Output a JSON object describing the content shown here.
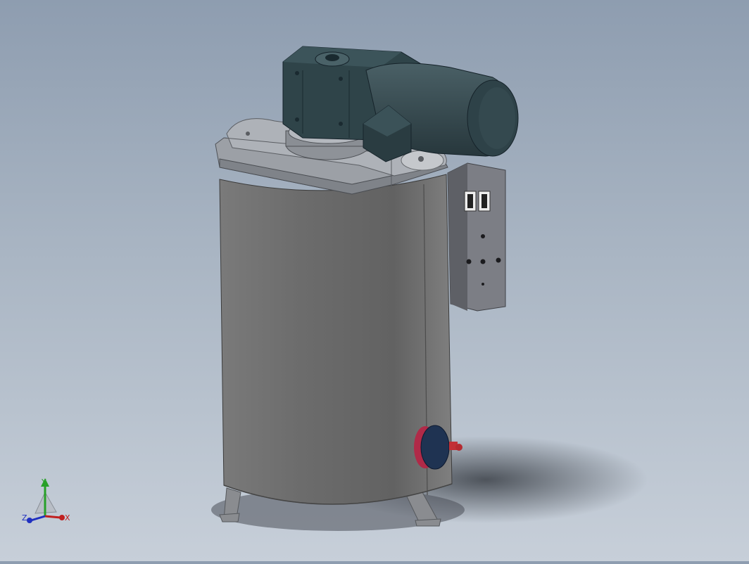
{
  "viewport": {
    "background_top": "#8e9db0",
    "background_bottom": "#c7cfd9",
    "model": {
      "tank_color": "#6e6e6e",
      "lid_color": "#9a9ea4",
      "motor_color": "#34484e",
      "panel_color": "#7d7f86",
      "flange_color": "#1f3352",
      "valve_color": "#c0304a"
    }
  },
  "triad": {
    "x_label": "X",
    "y_label": "Y",
    "z_label": "Z",
    "x_color": "#c02020",
    "y_color": "#28a028",
    "z_color": "#2030c0"
  }
}
